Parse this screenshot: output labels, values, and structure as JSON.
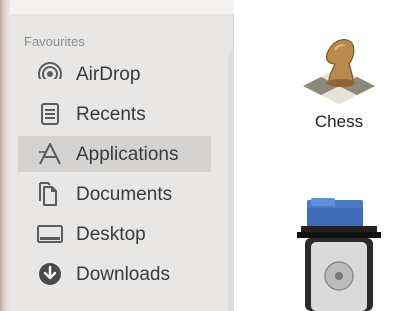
{
  "sidebar": {
    "heading": "Favourites",
    "items": [
      {
        "label": "AirDrop",
        "icon": "airdrop-icon"
      },
      {
        "label": "Recents",
        "icon": "recents-icon"
      },
      {
        "label": "Applications",
        "icon": "applications-icon",
        "selected": true
      },
      {
        "label": "Documents",
        "icon": "documents-icon"
      },
      {
        "label": "Desktop",
        "icon": "desktop-icon"
      },
      {
        "label": "Downloads",
        "icon": "downloads-icon"
      }
    ]
  },
  "main": {
    "apps": [
      {
        "label": "Chess",
        "icon": "chess-app-icon"
      },
      {
        "label": "",
        "icon": "disk-utility-app-icon"
      }
    ]
  },
  "colors": {
    "sidebar_bg": "#e8e7e6",
    "selected_bg": "#d4d3d2",
    "text": "#3a3a3a",
    "heading": "#8d8c8b"
  }
}
